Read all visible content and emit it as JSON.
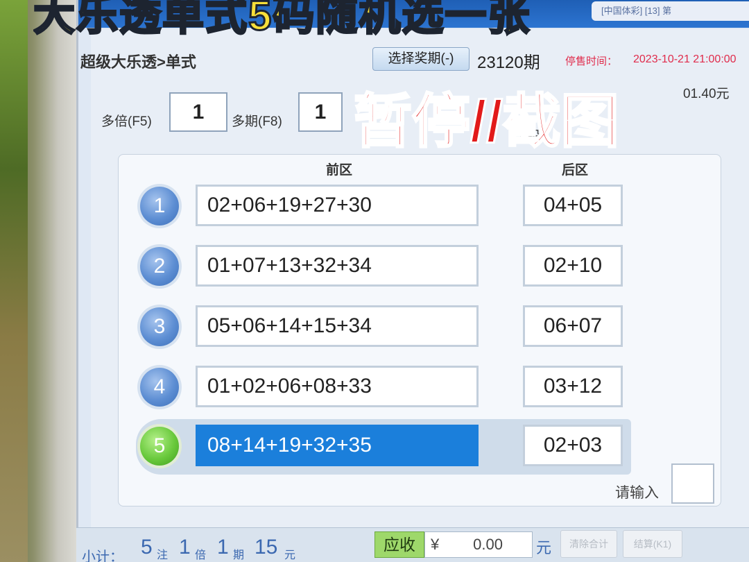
{
  "overlay": {
    "top_caption": "大乐透单式5码随机选一张",
    "red_caption": "暂停//截图"
  },
  "titlebar": {
    "tag": "[中国体彩] [13] 第"
  },
  "header": {
    "play_type": "超级大乐透>单式",
    "period_button": "选择奖期(-)",
    "period_number": "23120期",
    "stop_label": "停售时间：",
    "stop_time": "2023-10-21 21:00:00",
    "balance": "01.40元",
    "hint_partial": "自 投"
  },
  "controls": {
    "multiple_label": "多倍(F5)",
    "multiple_value": "1",
    "multi_period_label": "多期(F8)",
    "multi_period_value": "1"
  },
  "table": {
    "front_header": "前区",
    "back_header": "后区",
    "rows": [
      {
        "index": "1",
        "front": "02+06+19+27+30",
        "back": "04+05"
      },
      {
        "index": "2",
        "front": "01+07+13+32+34",
        "back": "02+10"
      },
      {
        "index": "3",
        "front": "05+06+14+15+34",
        "back": "06+07"
      },
      {
        "index": "4",
        "front": "01+02+06+08+33",
        "back": "03+12"
      },
      {
        "index": "5",
        "front": "08+14+19+32+35",
        "back": "02+03"
      }
    ],
    "active_row": 5
  },
  "input": {
    "label": "请输入"
  },
  "footer": {
    "subtotal_label": "小计：",
    "bets_value": "5",
    "bets_unit": "注",
    "multiple_value": "1",
    "multiple_unit": "倍",
    "period_value": "1",
    "period_unit": "期",
    "amount_value": "15",
    "amount_unit": "元",
    "due_label": "应收",
    "currency": "¥",
    "due_amount": "0.00",
    "due_unit": "元",
    "clear_button": "清除合计",
    "settle_button": "结算(K1)"
  },
  "colors": {
    "selected_row": "#1b7fdb",
    "ball_blue": "#5d8ed3",
    "ball_green": "#69c93c",
    "accent_red": "#e02b4b",
    "caption_yellow": "#f7df39"
  }
}
